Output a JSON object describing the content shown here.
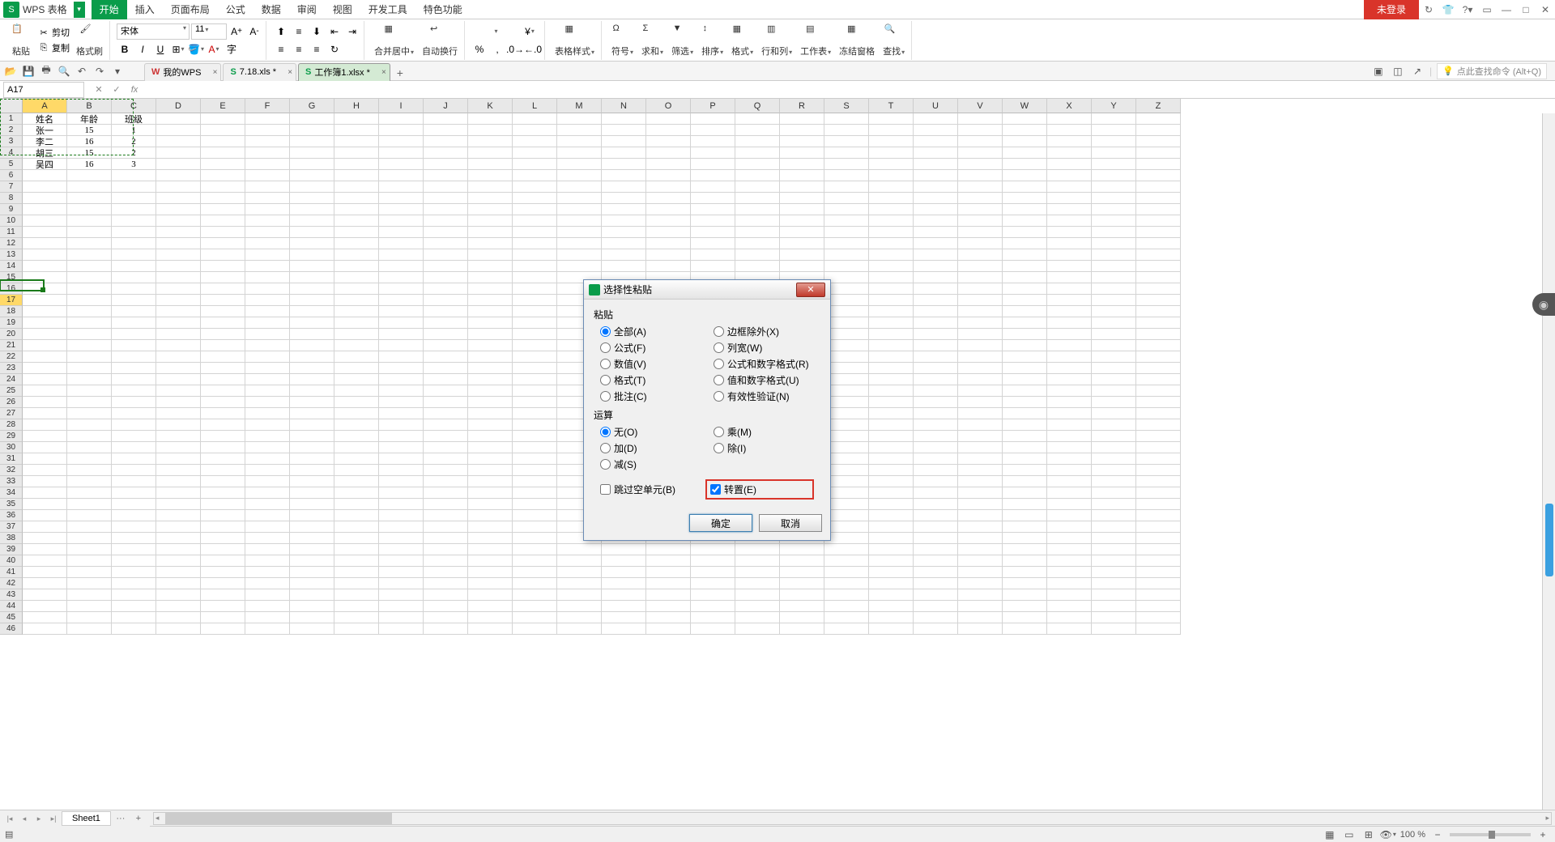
{
  "app": {
    "name": "WPS 表格"
  },
  "menu": [
    "开始",
    "插入",
    "页面布局",
    "公式",
    "数据",
    "审阅",
    "视图",
    "开发工具",
    "特色功能"
  ],
  "title_right": {
    "login": "未登录"
  },
  "ribbon": {
    "paste": "粘贴",
    "cut": "剪切",
    "copy": "复制",
    "format_painter": "格式刷",
    "font_name": "宋体",
    "font_size": "11",
    "merge": "合并居中",
    "wrap": "自动换行",
    "table_style": "表格样式",
    "symbol": "符号",
    "sum": "求和",
    "filter": "筛选",
    "sort": "排序",
    "format": "格式",
    "rowcol": "行和列",
    "worksheet": "工作表",
    "freeze": "冻结窗格",
    "find": "查找"
  },
  "doc_tabs": [
    {
      "label": "我的WPS",
      "active": false,
      "icon": "W"
    },
    {
      "label": "7.18.xls *",
      "active": false,
      "icon": "S"
    },
    {
      "label": "工作簿1.xlsx *",
      "active": true,
      "icon": "S"
    }
  ],
  "search_hint": "点此查找命令  (Alt+Q)",
  "name_box": "A17",
  "columns": [
    "A",
    "B",
    "C",
    "D",
    "E",
    "F",
    "G",
    "H",
    "I",
    "J",
    "K",
    "L",
    "M",
    "N",
    "O",
    "P",
    "Q",
    "R",
    "S",
    "T",
    "U",
    "V",
    "W",
    "X",
    "Y",
    "Z"
  ],
  "data_rows": [
    [
      "姓名",
      "年龄",
      "班级"
    ],
    [
      "张一",
      "15",
      "1"
    ],
    [
      "李二",
      "16",
      "2"
    ],
    [
      "胡三",
      "15",
      "2"
    ],
    [
      "吴四",
      "16",
      "3"
    ]
  ],
  "sheet": {
    "name": "Sheet1"
  },
  "status": {
    "zoom": "100 %"
  },
  "dialog": {
    "title": "选择性粘贴",
    "group_paste": "粘贴",
    "paste_opts": [
      [
        "全部(A)",
        "边框除外(X)"
      ],
      [
        "公式(F)",
        "列宽(W)"
      ],
      [
        "数值(V)",
        "公式和数字格式(R)"
      ],
      [
        "格式(T)",
        "值和数字格式(U)"
      ],
      [
        "批注(C)",
        "有效性验证(N)"
      ]
    ],
    "group_op": "运算",
    "op_opts": [
      [
        "无(O)",
        "乘(M)"
      ],
      [
        "加(D)",
        "除(I)"
      ],
      [
        "减(S)",
        ""
      ]
    ],
    "skip_blanks": "跳过空单元(B)",
    "transpose": "转置(E)",
    "ok": "确定",
    "cancel": "取消"
  }
}
